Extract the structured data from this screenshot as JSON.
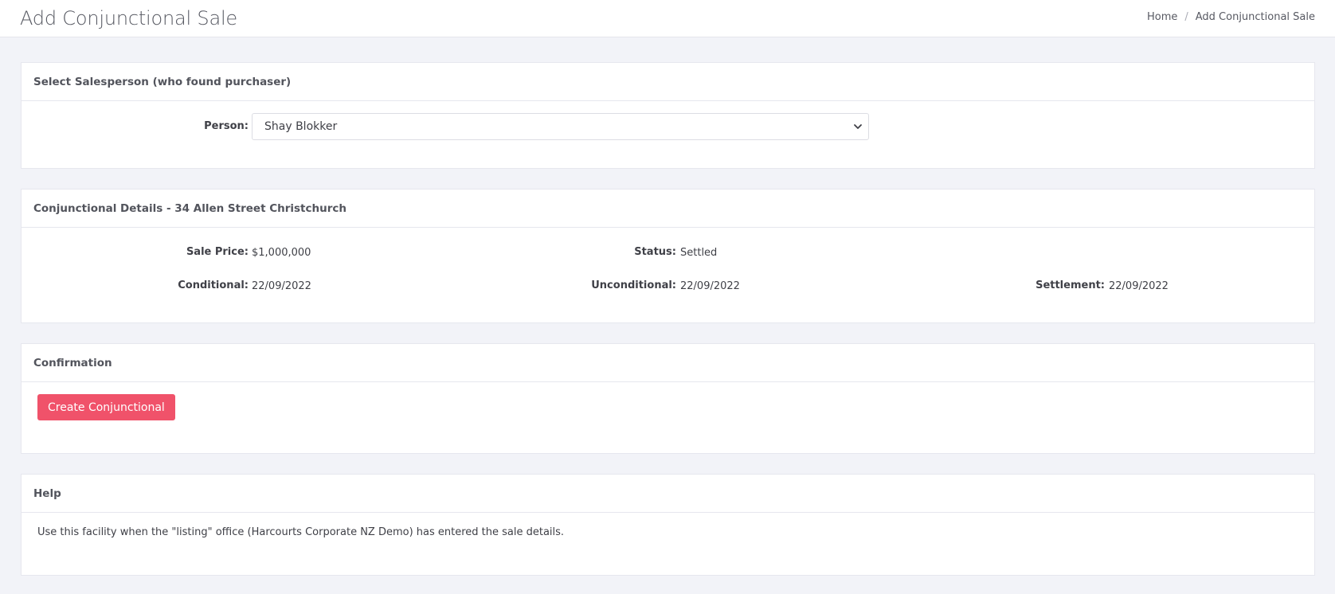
{
  "header": {
    "title": "Add Conjunctional Sale",
    "breadcrumb": {
      "home": "Home",
      "separator": "/",
      "current": "Add Conjunctional Sale"
    }
  },
  "salesperson_panel": {
    "title": "Select Salesperson (who found purchaser)",
    "person_label": "Person:",
    "person_selected": "Shay Blokker"
  },
  "details_panel": {
    "title": "Conjunctional Details - 34 Allen Street Christchurch",
    "sale_price_label": "Sale Price:",
    "sale_price": "$1,000,000",
    "status_label": "Status:",
    "status": "Settled",
    "conditional_label": "Conditional:",
    "conditional": "22/09/2022",
    "unconditional_label": "Unconditional:",
    "unconditional": "22/09/2022",
    "settlement_label": "Settlement:",
    "settlement": "22/09/2022"
  },
  "confirmation_panel": {
    "title": "Confirmation",
    "create_button": "Create Conjunctional"
  },
  "help_panel": {
    "title": "Help",
    "text": "Use this facility when the \"listing\" office (Harcourts Corporate NZ Demo) has entered the sale details."
  },
  "colors": {
    "page_background": "#f2f3f8",
    "panel_background": "#ffffff",
    "primary_button": "#f0526a"
  }
}
